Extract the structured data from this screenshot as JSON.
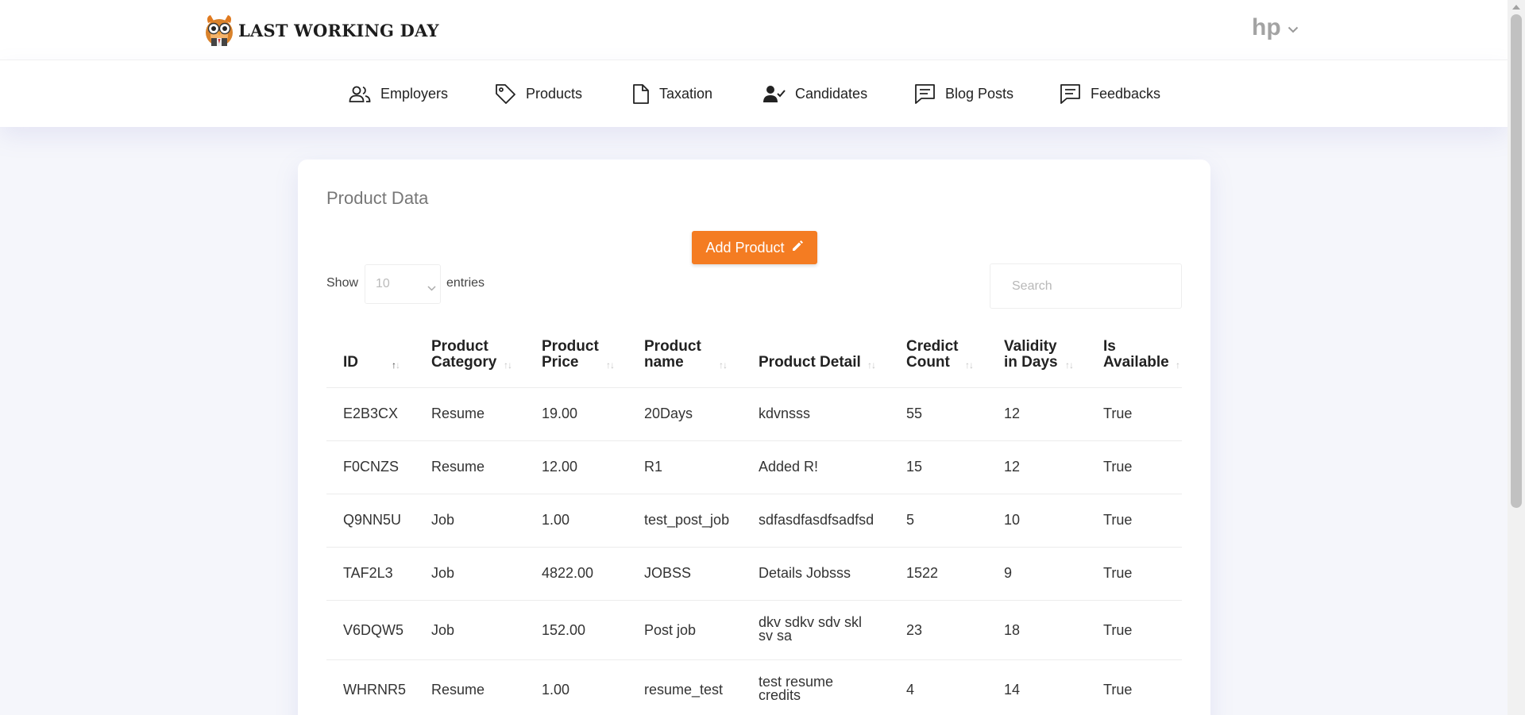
{
  "brand": {
    "name": "LAST WORKING DAY",
    "logo_icon": "owl-logo-icon"
  },
  "user": {
    "name": "hp"
  },
  "nav": [
    {
      "label": "Employers",
      "icon": "users-icon"
    },
    {
      "label": "Products",
      "icon": "tag-icon"
    },
    {
      "label": "Taxation",
      "icon": "document-icon"
    },
    {
      "label": "Candidates",
      "icon": "user-check-icon"
    },
    {
      "label": "Blog Posts",
      "icon": "message-icon"
    },
    {
      "label": "Feedbacks",
      "icon": "message-icon"
    }
  ],
  "page": {
    "title": "Product Data",
    "add_button": "Add Product",
    "show_label": "Show",
    "entries_label": "entries",
    "page_length": "10",
    "search_placeholder": "Search"
  },
  "table": {
    "columns": [
      {
        "l1": "ID",
        "l2": ""
      },
      {
        "l1": "Product",
        "l2": "Category"
      },
      {
        "l1": "Product",
        "l2": "Price"
      },
      {
        "l1": "Product",
        "l2": "name"
      },
      {
        "l1": "Product Detail",
        "l2": ""
      },
      {
        "l1": "Credict",
        "l2": "Count"
      },
      {
        "l1": "Validity",
        "l2": "in Days"
      },
      {
        "l1": "Is",
        "l2": "Available"
      }
    ],
    "sorted_column": "ID",
    "rows": [
      {
        "id": "E2B3CX",
        "category": "Resume",
        "price": "19.00",
        "name": "20Days",
        "detail_l1": "kdvnsss",
        "detail_l2": "",
        "credit": "55",
        "validity": "12",
        "available": "True"
      },
      {
        "id": "F0CNZS",
        "category": "Resume",
        "price": "12.00",
        "name": "R1",
        "detail_l1": "Added R!",
        "detail_l2": "",
        "credit": "15",
        "validity": "12",
        "available": "True"
      },
      {
        "id": "Q9NN5U",
        "category": "Job",
        "price": "1.00",
        "name": "test_post_job",
        "detail_l1": "sdfasdfasdfsadfsd",
        "detail_l2": "",
        "credit": "5",
        "validity": "10",
        "available": "True"
      },
      {
        "id": "TAF2L3",
        "category": "Job",
        "price": "4822.00",
        "name": "JOBSS",
        "detail_l1": "Details Jobsss",
        "detail_l2": "",
        "credit": "1522",
        "validity": "9",
        "available": "True"
      },
      {
        "id": "V6DQW5",
        "category": "Job",
        "price": "152.00",
        "name": "Post job",
        "detail_l1": "dkv sdkv sdv skl",
        "detail_l2": "sv sa",
        "credit": "23",
        "validity": "18",
        "available": "True"
      },
      {
        "id": "WHRNR5",
        "category": "Resume",
        "price": "1.00",
        "name": "resume_test",
        "detail_l1": "test resume",
        "detail_l2": "credits",
        "credit": "4",
        "validity": "14",
        "available": "True"
      }
    ]
  },
  "colors": {
    "accent": "#f47c22",
    "background": "#f5f6fb",
    "card": "#ffffff"
  }
}
